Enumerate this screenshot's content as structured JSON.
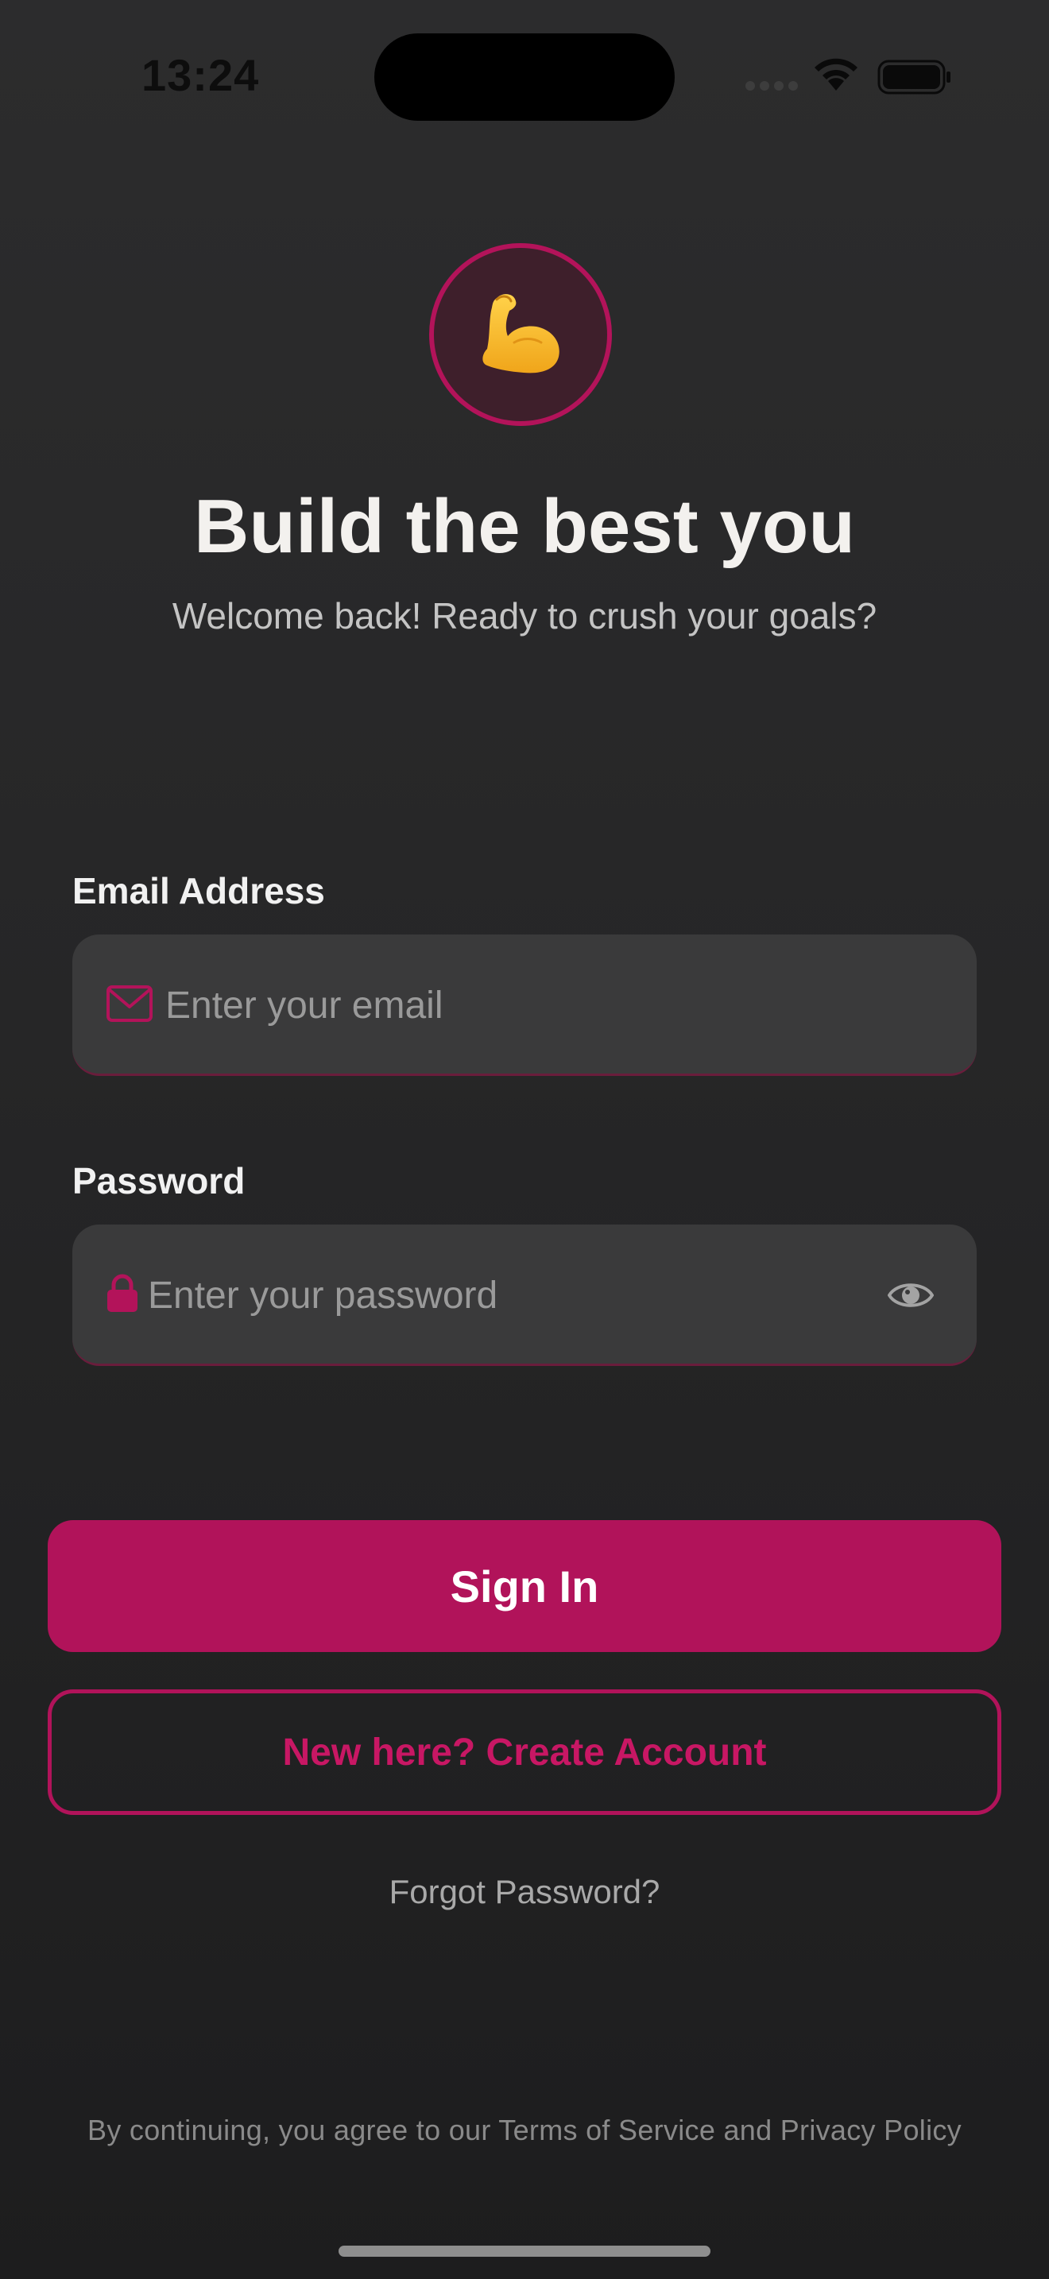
{
  "status_bar": {
    "time": "13:24"
  },
  "header": {
    "logo_icon": "flexed-biceps-icon",
    "title": "Build the best you",
    "subtitle": "Welcome back! Ready to crush your goals?"
  },
  "form": {
    "email": {
      "label": "Email Address",
      "placeholder": "Enter your email",
      "value": "",
      "icon": "envelope-icon"
    },
    "password": {
      "label": "Password",
      "placeholder": "Enter your password",
      "value": "",
      "icon": "lock-icon",
      "toggle_icon": "eye-icon"
    }
  },
  "actions": {
    "sign_in_label": "Sign In",
    "create_account_label": "New here? Create Account",
    "forgot_password_label": "Forgot Password?"
  },
  "footer": {
    "terms_text": "By continuing, you agree to our Terms of Service and Privacy Policy"
  },
  "colors": {
    "accent": "#b1135a",
    "background": "#262627",
    "input_background": "#3a3a3b"
  }
}
